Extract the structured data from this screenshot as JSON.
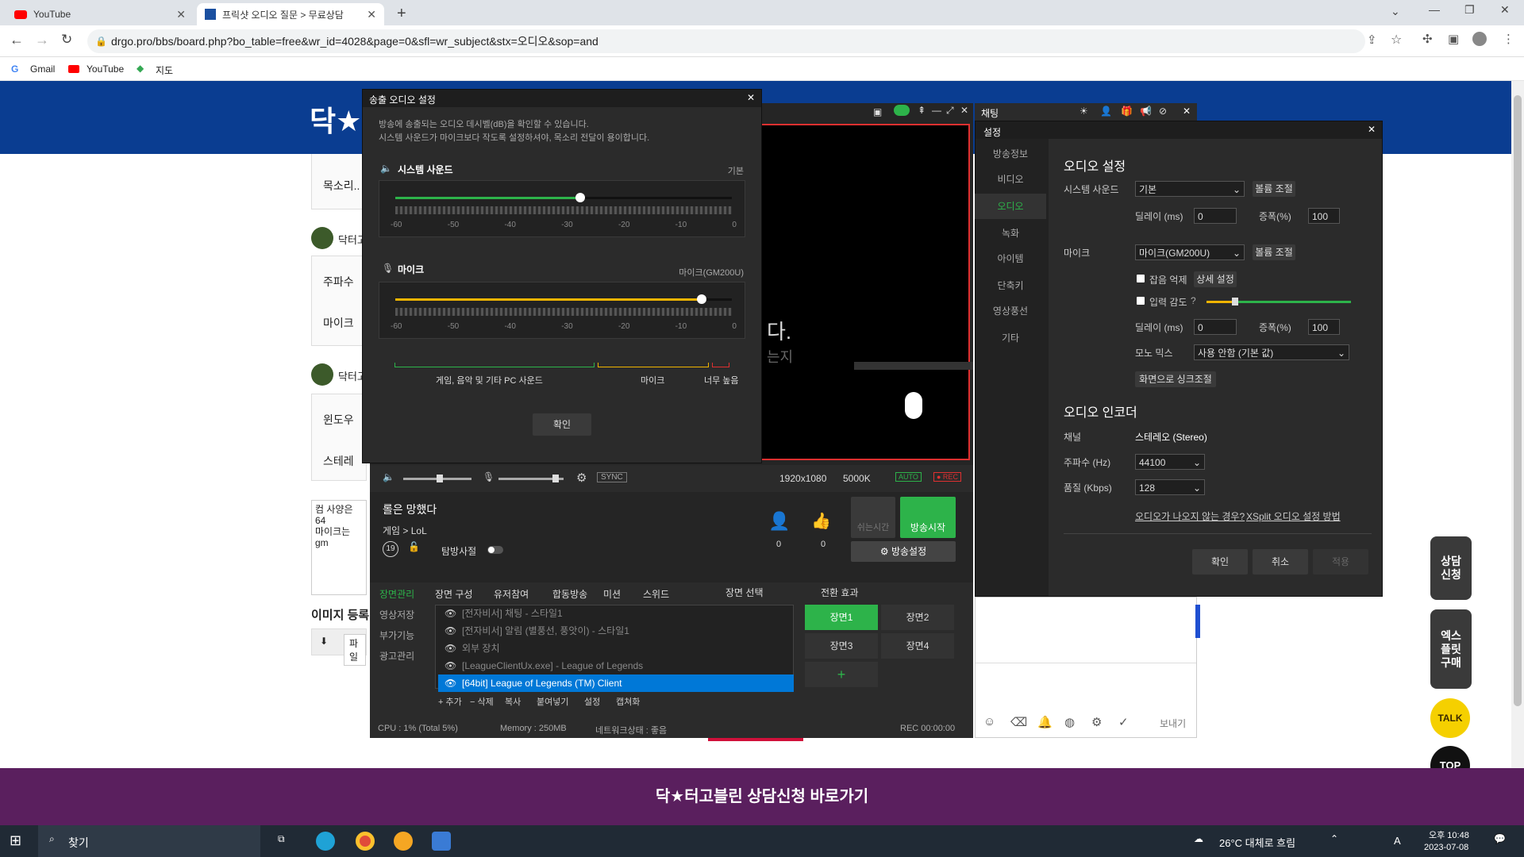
{
  "browser": {
    "tabs": [
      {
        "label": "YouTube"
      },
      {
        "label": "프릭샷 오디오 질문 > 무료상담"
      }
    ],
    "url": "drgo.pro/bbs/board.php?bo_table=free&wr_id=4028&page=0&sfl=wr_subject&stx=오디오&sop=and",
    "bookmarks": [
      "Gmail",
      "YouTube",
      "지도"
    ]
  },
  "page": {
    "logo": "닥★",
    "comments": [
      "목소리..",
      "닥터고",
      "주파수",
      "마이크",
      "닥터고",
      "윈도우",
      "스테레"
    ],
    "textarea": "컴 사양은 64",
    "textarea2": "마이크는 gm",
    "image_reg": "이미지 등록",
    "file_btn": "파일",
    "footer": "닥★터고블린 상담신청 바로가기",
    "side": [
      "상담\n신청",
      "엑스\n플릿\n구매"
    ],
    "talk": "TALK",
    "top": "TOP"
  },
  "audio_dialog": {
    "title": "송출 오디오 설정",
    "desc1": "방송에 송출되는 오디오 데시벨(dB)을 확인할 수 있습니다.",
    "desc2": "시스템 사운드가 마이크보다 작도록 설정하셔야, 목소리 전달이 용이합니다.",
    "system": {
      "label": "시스템 사운드",
      "value": "기본",
      "level": 0.55
    },
    "mic": {
      "label": "마이크",
      "value": "마이크(GM200U)",
      "level": 0.91
    },
    "ticks": [
      "-60",
      "-50",
      "-40",
      "-30",
      "-20",
      "-10",
      "0"
    ],
    "legend": [
      "게임, 음악 및 기타 PC 사운드",
      "마이크",
      "너무 높음"
    ],
    "ok": "확인"
  },
  "main": {
    "resolution": "1920x1080",
    "bitrate": "5000K",
    "auto": "AUTO",
    "rec": "● REC",
    "sync": "SYNC",
    "title": "롤은 망했다",
    "category": "게임 > LoL",
    "age": "19",
    "ban_label": "탐방사절",
    "viewers": "0",
    "up": "0",
    "pause": "쉬는시간",
    "start": "방송시작",
    "settings": "방송설정",
    "tabs_left": [
      "장면관리",
      "영상저장",
      "부가기능",
      "광고관리"
    ],
    "scene_cfg": "장면 구성",
    "toolbar": [
      "유저참여",
      "합동방송",
      "미션",
      "스위드"
    ],
    "sources": [
      "[전자비서] 채팅 - 스타일1",
      "[전자비서] 알림 (별풍선, 풍앗이) - 스타일1",
      "외부 장치",
      "[LeagueClientUx.exe] - League of Legends",
      "[64bit] League of Legends (TM) Client"
    ],
    "src_actions": [
      "+ 추가",
      "− 삭제",
      "복사",
      "붙여넣기",
      "설정",
      "캡쳐화"
    ],
    "scene_select": "장면 선택",
    "transition": "전환 효과",
    "scenes": [
      "장면1",
      "장면2",
      "장면3",
      "장면4"
    ],
    "status": [
      "CPU : 1% (Total 5%)",
      "Memory : 250MB",
      "네트워크상태 : 좋음",
      "REC 00:00:00"
    ],
    "preview_text": "다.",
    "preview_text2": "는지"
  },
  "chat": {
    "title": "채팅",
    "send": "보내기"
  },
  "settings": {
    "title": "설정",
    "nav": [
      "방송정보",
      "비디오",
      "오디오",
      "녹화",
      "아이템",
      "단축키",
      "영상풍선",
      "기타"
    ],
    "audio_title": "오디오 설정",
    "system_label": "시스템 사운드",
    "system_val": "기본",
    "vol_btn": "볼륨 조절",
    "delay": "딜레이 (ms)",
    "delay_val": "0",
    "boost": "증폭(%)",
    "boost_val": "100",
    "mic_label": "마이크",
    "mic_val": "마이크(GM200U)",
    "noise": "잡음 억제",
    "detail": "상세 설정",
    "sens": "입력 감도",
    "mono": "모노 믹스",
    "mono_val": "사용 안함 (기본 값)",
    "sync_btn": "화면으로 싱크조절",
    "enc_title": "오디오 인코더",
    "channel": "채널",
    "channel_val": "스테레오 (Stereo)",
    "freq": "주파수 (Hz)",
    "freq_val": "44100",
    "quality": "품질 (Kbps)",
    "quality_val": "128",
    "link1": "오디오가 나오지 않는 경우?",
    "link2": "XSplit 오디오 설정 방법",
    "ok": "확인",
    "cancel": "취소",
    "apply": "적용"
  },
  "taskbar": {
    "search": "찾기",
    "weather": "26°C 대체로 흐림",
    "time": "오후 10:48",
    "date": "2023-07-08",
    "lang": "A"
  },
  "colors": {
    "green": "#2db34a",
    "yellow": "#f0b400",
    "red": "#e03030"
  }
}
